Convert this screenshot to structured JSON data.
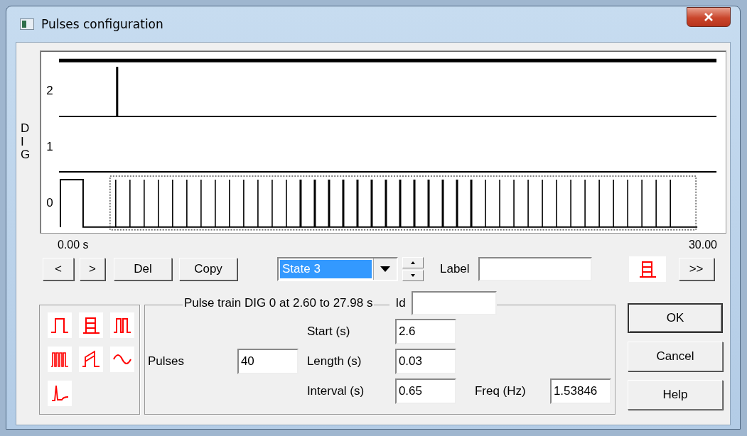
{
  "window": {
    "title": "Pulses configuration"
  },
  "plot": {
    "axis_label": "DIG",
    "channels": [
      {
        "label": "2"
      },
      {
        "label": "1"
      },
      {
        "label": "0"
      }
    ],
    "start_time": "0.00 s",
    "end_time": "30.00"
  },
  "nav_buttons": [
    {
      "label": "<"
    },
    {
      "label": ">"
    },
    {
      "label": "Del"
    },
    {
      "label": "Copy"
    }
  ],
  "state_select": {
    "value": "State 3"
  },
  "label_field": {
    "label": "Label"
  },
  "current_type": {
    "kind": "train"
  },
  "next_button": {
    "label": ">>"
  },
  "pulse_types": [
    {
      "kind": "single"
    },
    {
      "kind": "train"
    },
    {
      "kind": "double"
    },
    {
      "kind": "burst"
    },
    {
      "kind": "ramp"
    },
    {
      "kind": "sine"
    },
    {
      "kind": "spike"
    }
  ],
  "group": {
    "title": "Pulse train DIG 0 at 2.60 to 27.98 s",
    "id_label": "Id"
  },
  "pulses": {
    "label": "Pulses",
    "value": "40"
  },
  "fields": [
    {
      "label": "Start (s)",
      "value": "2.6"
    },
    {
      "label": "Length (s)",
      "value": "0.03"
    },
    {
      "label": "Interval (s)",
      "value": "0.65"
    }
  ],
  "freq": {
    "label": "Freq (Hz)",
    "value": "1.53846"
  },
  "buttons": [
    {
      "label": "OK",
      "default": true
    },
    {
      "label": "Cancel",
      "default": false
    },
    {
      "label": "Help",
      "default": false
    }
  ]
}
